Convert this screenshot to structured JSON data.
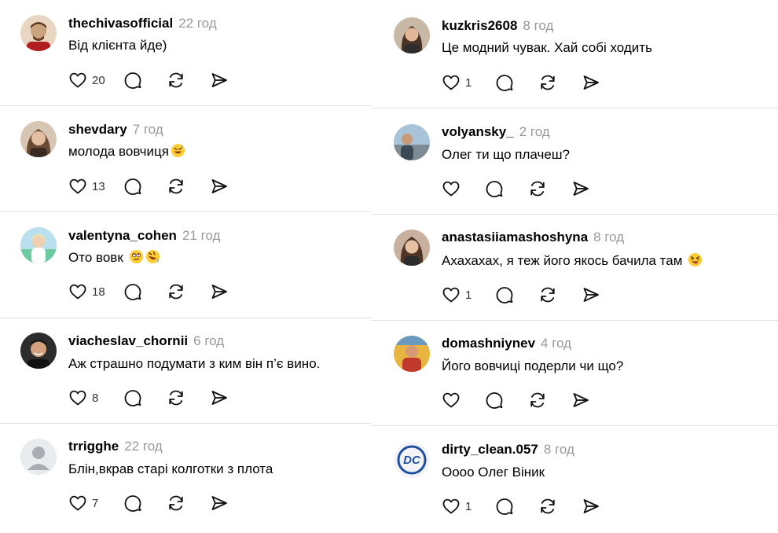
{
  "left_column": [
    {
      "username": "thechivasofficial",
      "time": "22 год",
      "text": "Від клієнта йде)",
      "likes": "20",
      "avatar_color": "#c9a27e"
    },
    {
      "username": "shevdary",
      "time": "7 год",
      "text": "молода вовчиця",
      "likes": "13",
      "emoji": [
        "grin-sweat"
      ],
      "avatar_color": "#b8906c"
    },
    {
      "username": "valentyna_cohen",
      "time": "21 год",
      "text": "Ото вовк",
      "likes": "18",
      "emoji": [
        "eye-roll",
        "rofl"
      ],
      "avatar_color": "#8fc6d8"
    },
    {
      "username": "viacheslav_chornii",
      "time": "6 год",
      "text": "Аж страшно подумати з ким він п’є вино.",
      "likes": "8",
      "avatar_color": "#3a3a3a"
    },
    {
      "username": "trrigghe",
      "time": "22 год",
      "text": "Блін,вкрав старі колготки з плота",
      "likes": "7",
      "avatar_color": "#cfd3d6"
    }
  ],
  "right_column": [
    {
      "username": "kuzkris2608",
      "time": "8 год",
      "text": "Це модний чувак. Хай собі ходить",
      "likes": "1",
      "avatar_color": "#8a6e5a"
    },
    {
      "username": "volyansky_",
      "time": "2 год",
      "text": "Олег ти що плачеш?",
      "likes": "",
      "avatar_color": "#6f8fa8"
    },
    {
      "username": "anastasiiamashoshyna",
      "time": "8 год",
      "text": "Ахахахах, я теж його якось бачила там",
      "likes": "1",
      "emoji": [
        "squint-tongue"
      ],
      "avatar_color": "#7a5b4b"
    },
    {
      "username": "domashniynev",
      "time": "4 год",
      "text": "Його вовчиці подерли чи що?",
      "likes": "",
      "avatar_color": "#d9a33a"
    },
    {
      "username": "dirty_clean.057",
      "time": "8 год",
      "text": "Оооо Олег Віник",
      "likes": "1",
      "avatar_color": "#1f4fa3"
    }
  ],
  "icons": {
    "like": "heart-icon",
    "reply": "comment-icon",
    "repost": "repost-icon",
    "share": "send-icon"
  }
}
